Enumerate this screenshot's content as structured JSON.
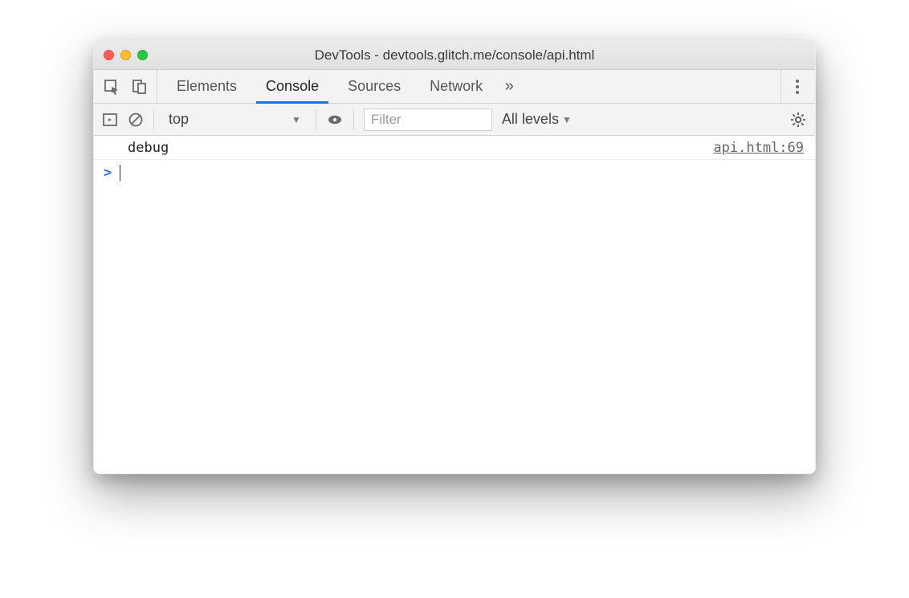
{
  "window": {
    "title": "DevTools - devtools.glitch.me/console/api.html"
  },
  "tabs": {
    "items": [
      "Elements",
      "Console",
      "Sources",
      "Network"
    ],
    "active_index": 1,
    "more_glyph": "»"
  },
  "toolbar": {
    "context": "top",
    "filter_placeholder": "Filter",
    "levels_label": "All levels"
  },
  "console": {
    "log": {
      "message": "debug",
      "source": "api.html:69"
    },
    "prompt_glyph": ">"
  }
}
